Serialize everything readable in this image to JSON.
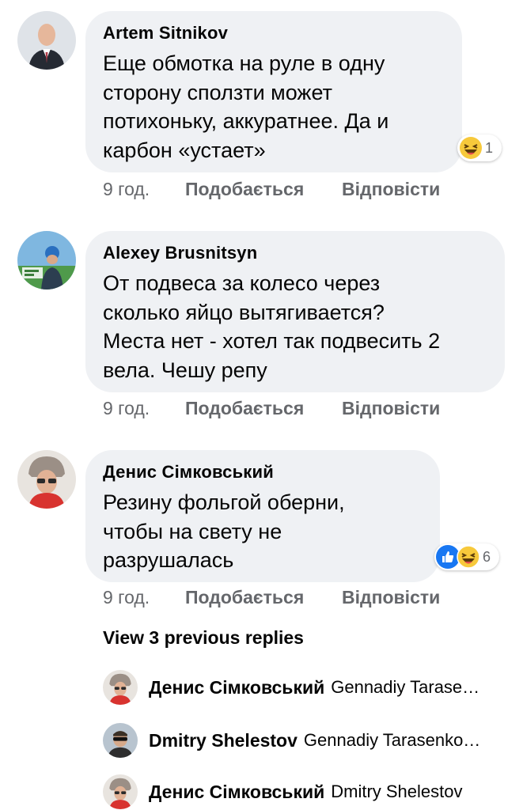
{
  "comments": [
    {
      "author": "Artem  Sitnikov",
      "text": "Еще обмотка на руле в одну\nсторону сползти может\nпотихоньку, аккуратнее. Да и\nкарбон «устает»",
      "reaction_count": "1",
      "reactions": [
        "haha-icon"
      ],
      "time": "9 год.",
      "like": "Подобається",
      "reply": "Відповісти"
    },
    {
      "author": "Alexey Brusnitsyn",
      "text": "От подвеса за колесо через\nсколько яйцо вытягивается?\nМеста нет - хотел так подвесить 2\nвела. Чешу репу",
      "time": "9 год.",
      "like": "Подобається",
      "reply": "Відповісти"
    },
    {
      "author": "Денис Сімковський",
      "text": "Резину фольгой  оберни,\nчтобы на свету не\nразрушалась",
      "reaction_count": "6",
      "reactions": [
        "like-icon",
        "haha-icon"
      ],
      "time": "9 год.",
      "like": "Подобається",
      "reply": "Відповісти"
    }
  ],
  "view_previous": "View 3 previous replies",
  "replies": [
    {
      "author": "Денис Сімковський",
      "text": "Gennadiy Tarase…"
    },
    {
      "author": "Dmitry Shelestov",
      "text": "Gennadiy Tarasenko…"
    },
    {
      "author": "Денис Сімковський",
      "text": "Dmitry Shelestov"
    }
  ],
  "colors": {
    "bubble": "#eff1f4",
    "meta_text": "#65676b",
    "like_blue": "#1877f2",
    "haha_yellow": "#f7c93b"
  }
}
